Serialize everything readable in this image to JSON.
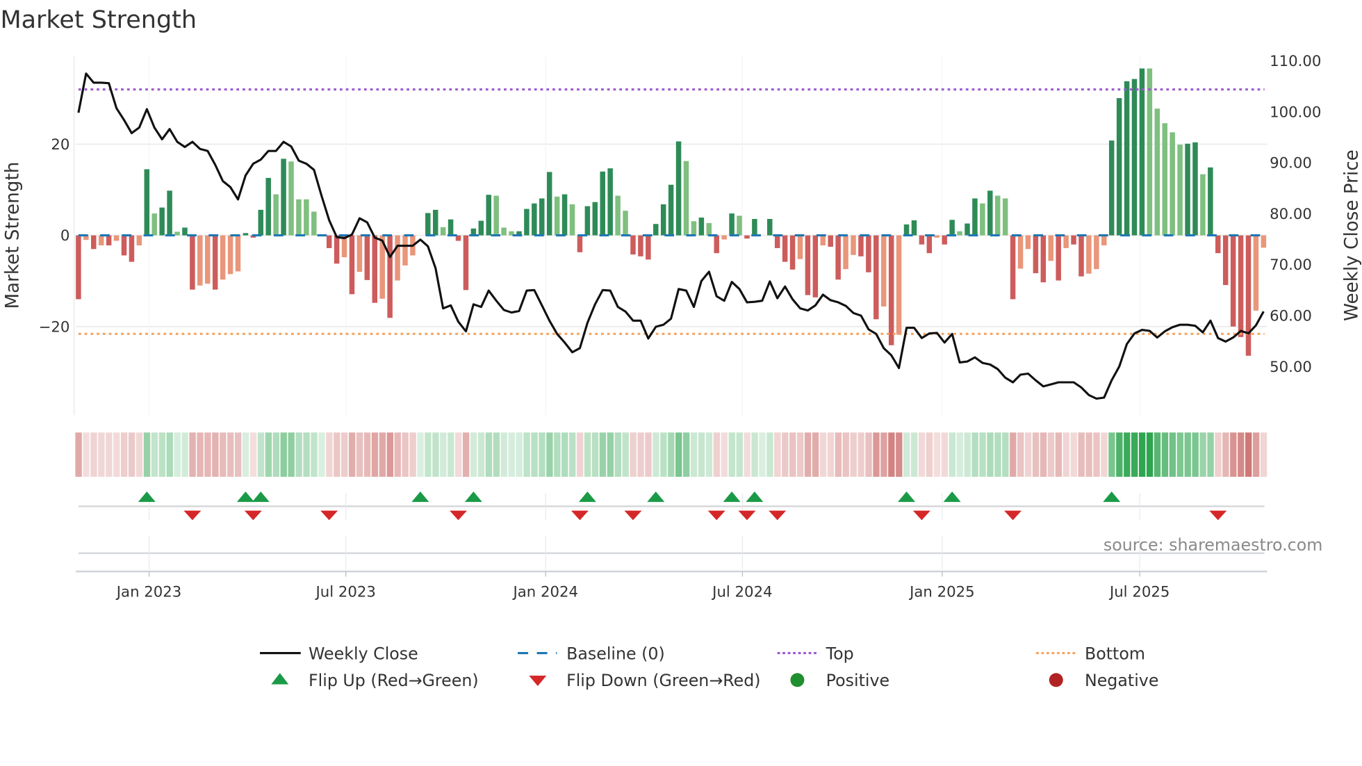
{
  "title": "Market Strength",
  "source": "source: sharemaestro.com",
  "colors": {
    "pos_dark": "#2e8b57",
    "pos_light": "#7fbf7f",
    "neg_dark": "#cd5c5c",
    "neg_light": "#e9967a",
    "strip_pos": "#2ea44f",
    "strip_neg": "#c0504d",
    "line": "#111111",
    "baseline": "#1f77b4",
    "top": "#9b59d0",
    "bottom": "#f4a460",
    "flip_up": "#1a9a47",
    "flip_down": "#d62728",
    "positive": "#1f8f2f",
    "negative": "#b22222"
  },
  "chart_data": {
    "type": "bar",
    "title": "Market Strength",
    "ylabel": "Market Strength",
    "y2label": "Weekly Close Price",
    "ylim": [
      -39.5,
      39.5
    ],
    "y_ticks": [
      {
        "v": 20,
        "label": "20"
      },
      {
        "v": 0,
        "label": "0"
      },
      {
        "v": -20,
        "label": "−20"
      }
    ],
    "y2lim": [
      42,
      111
    ],
    "y2_ticks": [
      {
        "v": 110,
        "label": "110.00"
      },
      {
        "v": 100,
        "label": "100.00"
      },
      {
        "v": 90,
        "label": "90.00"
      },
      {
        "v": 80,
        "label": "80.00"
      },
      {
        "v": 70,
        "label": "70.00"
      },
      {
        "v": 60,
        "label": "60.00"
      },
      {
        "v": 50,
        "label": "50.00"
      }
    ],
    "x_ticks": [
      {
        "week": 9.3,
        "label": "Jan 2023"
      },
      {
        "week": 35.2,
        "label": "Jul 2023"
      },
      {
        "week": 61.5,
        "label": "Jan 2024"
      },
      {
        "week": 87.4,
        "label": "Jul 2024"
      },
      {
        "week": 113.7,
        "label": "Jan 2025"
      },
      {
        "week": 139.7,
        "label": "Jul 2025"
      }
    ],
    "top_level": 32,
    "bottom_level": -21.6,
    "strength": [
      -14,
      -1,
      -3,
      -2.2,
      -2.2,
      -1.2,
      -4.4,
      -5.8,
      -2.2,
      14.5,
      4.8,
      6.1,
      9.8,
      0.8,
      1.7,
      -11.9,
      -11,
      -10.6,
      -11.9,
      -9.7,
      -8.5,
      -7.9,
      0.5,
      -0.5,
      5.6,
      12.6,
      9,
      16.8,
      16.2,
      7.9,
      7.9,
      5.2,
      0,
      -2.8,
      -6.2,
      -4.8,
      -12.9,
      -8,
      -9.8,
      -14.8,
      -13.9,
      -18.1,
      -9.9,
      -6.6,
      -4.4,
      0,
      4.9,
      5.6,
      1.8,
      3.5,
      -1.2,
      -12,
      1.5,
      3.2,
      8.9,
      8.7,
      1.7,
      0.9,
      0.9,
      5.8,
      7,
      8.1,
      13.9,
      8.5,
      9,
      6.8,
      -3.7,
      6.4,
      7.3,
      14,
      14.7,
      8.7,
      5.4,
      -4.2,
      -4.6,
      -5.3,
      2.5,
      6.8,
      11.1,
      20.6,
      16.3,
      3.1,
      3.9,
      2.7,
      -3.9,
      -0.9,
      4.8,
      4.3,
      -0.7,
      3.6,
      0,
      3.6,
      -2.8,
      -5.8,
      -7.5,
      -5.2,
      -13.1,
      -13.6,
      -2.2,
      -2.5,
      -9.7,
      -7.4,
      -4.3,
      -4.6,
      -8.1,
      -18.4,
      -15.6,
      -24.1,
      -21.8,
      2.4,
      3.3,
      -2,
      -3.9,
      -0.5,
      -2,
      3.4,
      0.9,
      2.6,
      8.1,
      7,
      9.8,
      8.7,
      8.1,
      -14,
      -7.3,
      -3,
      -8.3,
      -10.3,
      -5.6,
      -9.9,
      -2.8,
      -2,
      -9,
      -8.4,
      -7.4,
      -2.2,
      20.8,
      30.1,
      33.8,
      34.3,
      36.6,
      36.6,
      27.8,
      24.6,
      22.6,
      19.9,
      20.1,
      20.4,
      13.4,
      14.9,
      -3.9,
      -10.9,
      -20,
      -22.3,
      -26.4,
      -16.5,
      -2.7
    ],
    "shade": "DLDLDLDDLDLDDLDDLLDLLLDDDDLDLLLLLDDLDLDDLDLLLLDDLDDDDDDLLLDDDDDLDLDDDDDLLDDDDDDDLLDLDLDLDDDDDDDLDDLDDLLDDDLDLDDDDLDDLDDLDLLDLLDDLDLDDLLLDDDDDLLLLLDDLDDDDDDLL",
    "weekly_close": [
      99.8,
      107.5,
      105.7,
      105.7,
      105.6,
      100.7,
      98.4,
      95.8,
      96.9,
      100.5,
      96.9,
      94.6,
      96.6,
      94.1,
      93.1,
      94.1,
      92.7,
      92.3,
      89.6,
      86.4,
      85.2,
      82.8,
      87.5,
      89.8,
      90.6,
      92.3,
      92.3,
      94.1,
      93.2,
      90.4,
      89.8,
      88.6,
      83.5,
      78.7,
      75.4,
      75.2,
      75.9,
      79.1,
      78.3,
      75.3,
      74.7,
      71.5,
      73.7,
      73.7,
      73.7,
      74.9,
      73.6,
      69.3,
      61.4,
      62,
      58.8,
      56.9,
      62.2,
      61.7,
      64.9,
      62.9,
      61.1,
      60.6,
      60.9,
      64.9,
      65,
      62,
      59,
      56.4,
      54.7,
      52.8,
      53.6,
      58.6,
      62.2,
      65,
      64.9,
      61.7,
      60.8,
      59,
      59,
      55.5,
      57.8,
      58.2,
      59.4,
      65.2,
      64.9,
      61.7,
      66.8,
      68.6,
      63.8,
      62.9,
      66.6,
      65.2,
      62.6,
      62.7,
      62.9,
      66.7,
      63.4,
      65.7,
      63.2,
      61.4,
      61,
      62,
      64.1,
      63,
      62.6,
      61.9,
      60.5,
      60,
      57.3,
      56.4,
      53.6,
      52.2,
      49.7,
      57.6,
      57.6,
      55.6,
      56.5,
      56.6,
      54.7,
      56.4,
      50.8,
      51,
      51.8,
      50.7,
      50.4,
      49.5,
      47.8,
      46.9,
      48.4,
      48.6,
      47.3,
      46.1,
      46.5,
      46.9,
      46.9,
      46.9,
      45.9,
      44.4,
      43.7,
      43.9,
      47.3,
      50,
      54.4,
      56.5,
      57.2,
      57,
      55.7,
      56.9,
      57.7,
      58.2,
      58.2,
      58,
      56.7,
      59,
      55.6,
      54.9,
      55.7,
      57,
      56.5,
      58.1,
      60.8
    ],
    "flip_up_weeks": [
      9,
      22,
      24,
      45,
      52,
      67,
      76,
      86,
      89,
      109,
      115,
      136
    ],
    "flip_down_weeks": [
      15,
      23,
      33,
      50,
      66,
      73,
      84,
      88,
      92,
      111,
      123,
      150
    ],
    "legend": {
      "placement": "bottom",
      "items": [
        {
          "label": "Weekly Close",
          "kind": "line"
        },
        {
          "label": "Baseline (0)",
          "kind": "dash"
        },
        {
          "label": "Top",
          "kind": "dot-purple"
        },
        {
          "label": "Bottom",
          "kind": "dot-orange"
        },
        {
          "label": "Flip Up (Red→Green)",
          "kind": "tri-up"
        },
        {
          "label": "Flip Down (Green→Red)",
          "kind": "tri-down"
        },
        {
          "label": "Positive",
          "kind": "circle-green"
        },
        {
          "label": "Negative",
          "kind": "circle-red"
        }
      ]
    }
  }
}
